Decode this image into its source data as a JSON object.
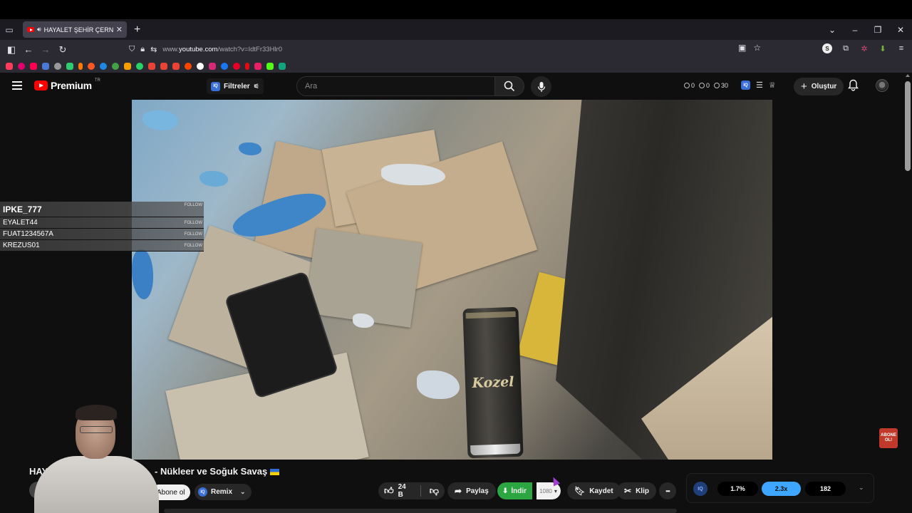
{
  "browser": {
    "tab_title": "HAYALET ŞEHİR ÇERNOBİL",
    "url_prefix": "www.",
    "url_host": "youtube.com",
    "url_path": "/watch?v=IdtFr33Hlr0",
    "new_tab_symbol": "+"
  },
  "youtube_header": {
    "logo_text": "Premium",
    "logo_superscript": "TR",
    "filters_label": "Filtreler",
    "iq_badge": "IQ",
    "search_placeholder": "Ara",
    "counters": [
      "0",
      "0",
      "30"
    ],
    "create_label": "Oluştur"
  },
  "follow_overlay": [
    {
      "name": "IPKE_777",
      "button": "FOLLOW"
    },
    {
      "name": "EYALET44",
      "button": "FOLLOW"
    },
    {
      "name": "FUAT1234567A",
      "button": "FOLLOW"
    },
    {
      "name": "KREZUS01",
      "button": "FOLLOW"
    }
  ],
  "video": {
    "can_label": "Kozel",
    "title_prefix": "HAYA",
    "title_suffix": "- Nükleer ve Soğuk Savaş",
    "flag_icon": "ukraine-flag-icon",
    "abone_badge": "ABONE OL!"
  },
  "actions": {
    "subscribe_label": "Abone ol",
    "remix_label": "Remix",
    "like_count": "24 B",
    "share_label": "Paylaş",
    "download_label": "İndir",
    "download_quality": "1080",
    "save_label": "Kaydet",
    "clip_label": "Klip",
    "more_label": "•••"
  },
  "stats_panel": {
    "iq_label": "IQ",
    "values": [
      "1.7%",
      "2.3x",
      "182"
    ]
  },
  "colors": {
    "youtube_red": "#ff0000",
    "download_green": "#2ba640",
    "accent_blue": "#3ea6ff"
  }
}
